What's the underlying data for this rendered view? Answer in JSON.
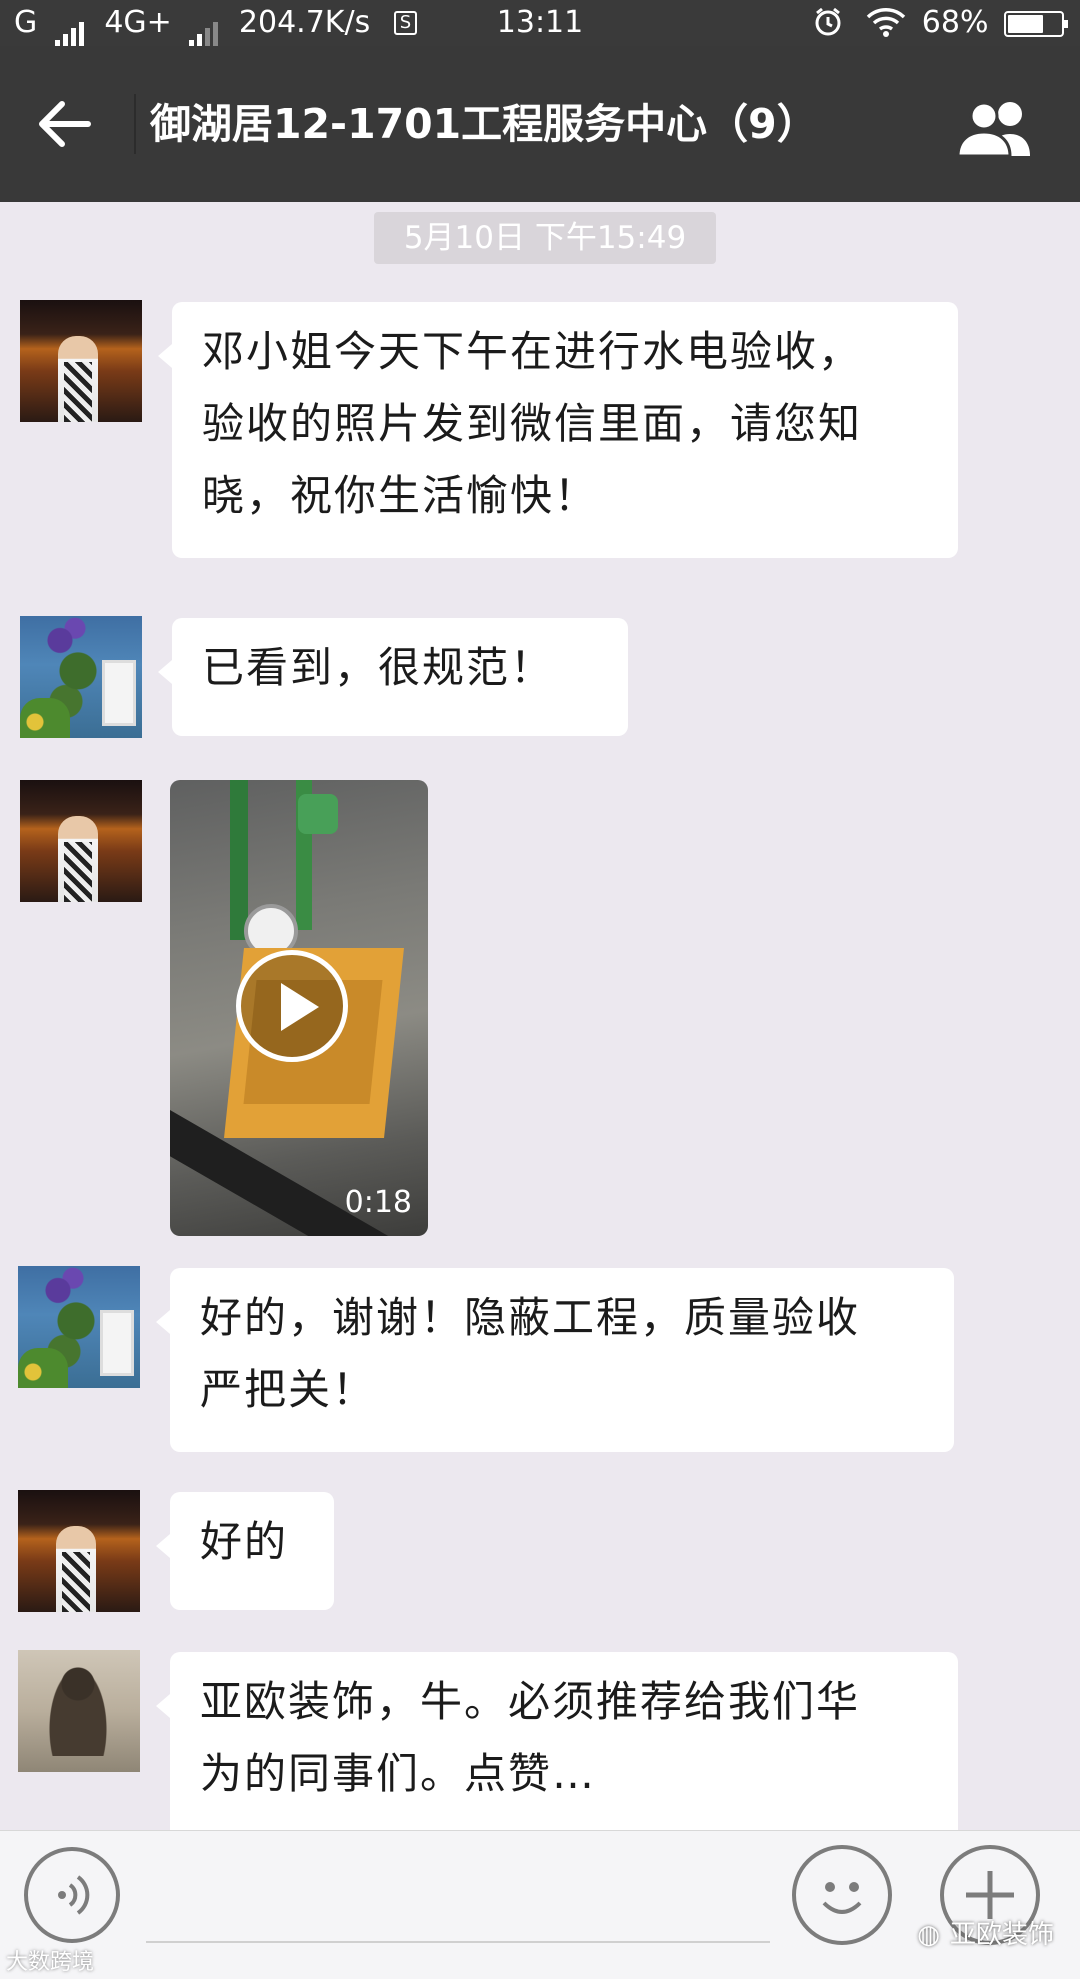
{
  "status_bar": {
    "carrier": "G",
    "network": "4G+",
    "speed": "204.7K/s",
    "s_badge": "S",
    "time": "13:11",
    "battery": "68%",
    "battery_level": 0.68
  },
  "header": {
    "title": "御湖居12-1701工程服务中心（9）"
  },
  "timestamp": "5月10日 下午15:49",
  "messages": [
    {
      "lines": [
        "邓小姐今天下午在进行水电验收，",
        "验收的照片发到微信里面，请您知",
        "晓，祝你生活愉快！"
      ]
    },
    {
      "lines": [
        "已看到，很规范！"
      ]
    },
    {
      "video_duration": "0:18"
    },
    {
      "lines": [
        "好的，谢谢！隐蔽工程，质量验收",
        "严把关！"
      ]
    },
    {
      "lines": [
        "好的"
      ]
    },
    {
      "lines": [
        "亚欧装饰，牛。必须推荐给我们华",
        "为的同事们。点赞…"
      ]
    }
  ],
  "watermarks": {
    "left": "大数跨境",
    "right": "亚欧装饰"
  }
}
